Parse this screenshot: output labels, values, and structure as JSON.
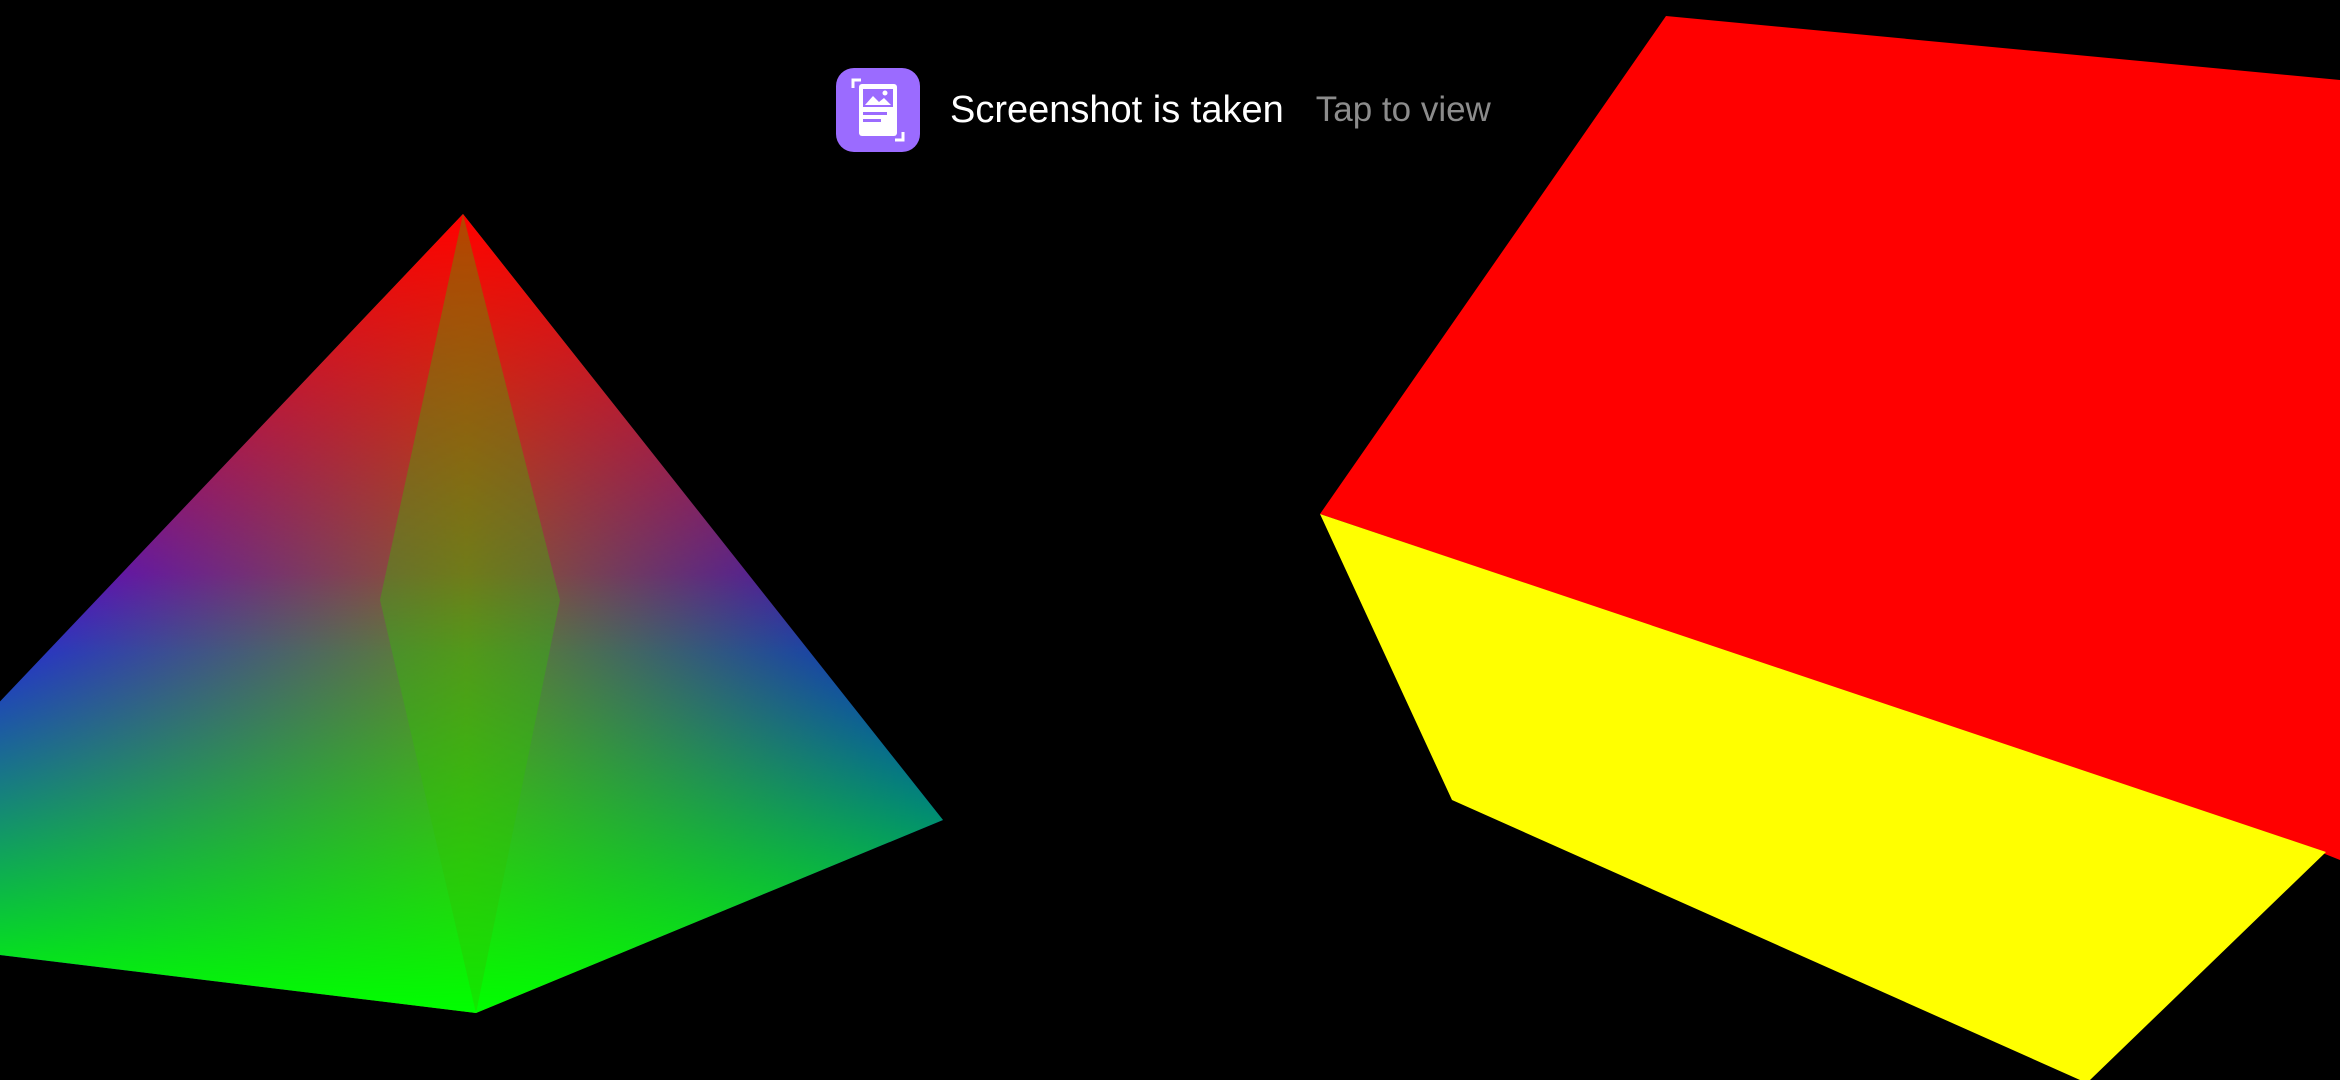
{
  "toast": {
    "title": "Screenshot is taken",
    "action_label": "Tap to view",
    "icon": "screenshot-icon",
    "icon_color": "#9b6bff"
  },
  "scene": {
    "pyramid": {
      "colors": {
        "apex": "#ff0000",
        "left": "#2a00ff",
        "right": "#0000ff",
        "bottom": "#00ff00"
      }
    },
    "cube": {
      "colors": {
        "top_face": "#ff0000",
        "side_face": "#ffff00"
      }
    }
  }
}
